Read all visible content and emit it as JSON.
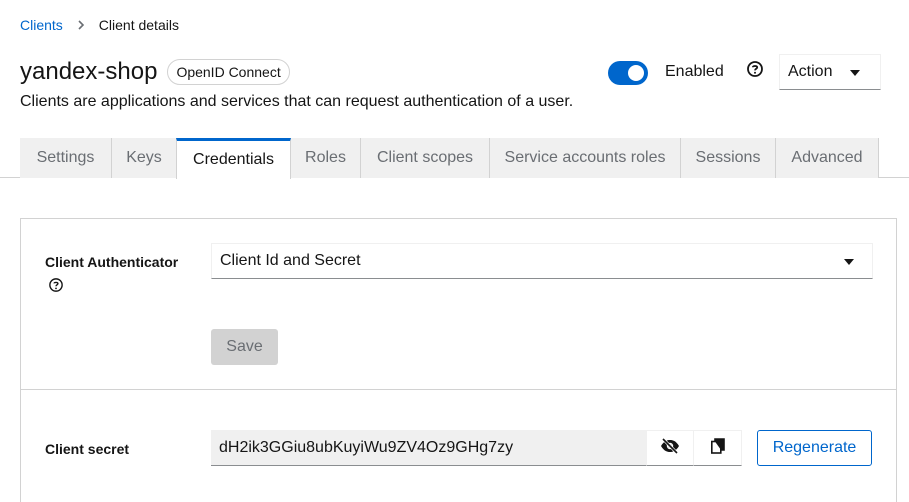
{
  "breadcrumb": {
    "parent": "Clients",
    "current": "Client details"
  },
  "header": {
    "title": "yandex-shop",
    "badge": "OpenID Connect",
    "subtitle": "Clients are applications and services that can request authentication of a user.",
    "enabled_label": "Enabled",
    "enabled": true,
    "action_label": "Action"
  },
  "tabs": [
    {
      "label": "Settings"
    },
    {
      "label": "Keys"
    },
    {
      "label": "Credentials",
      "active": true
    },
    {
      "label": "Roles"
    },
    {
      "label": "Client scopes"
    },
    {
      "label": "Service accounts roles"
    },
    {
      "label": "Sessions"
    },
    {
      "label": "Advanced"
    }
  ],
  "credentials": {
    "authenticator_label": "Client Authenticator",
    "authenticator_value": "Client Id and Secret",
    "save_label": "Save",
    "secret_label": "Client secret",
    "secret_value": "dH2ik3GGiu8ubKuyiWu9ZV4Oz9GHg7zy",
    "regenerate_label": "Regenerate"
  },
  "icons": {
    "breadcrumb_sep": "chevron-right-icon",
    "help": "question-circle-icon",
    "hide": "eye-slash-icon",
    "copy": "copy-icon"
  },
  "colors": {
    "accent": "#0066cc",
    "tab_bg": "#f0f0f0",
    "border": "#d2d2d2"
  }
}
